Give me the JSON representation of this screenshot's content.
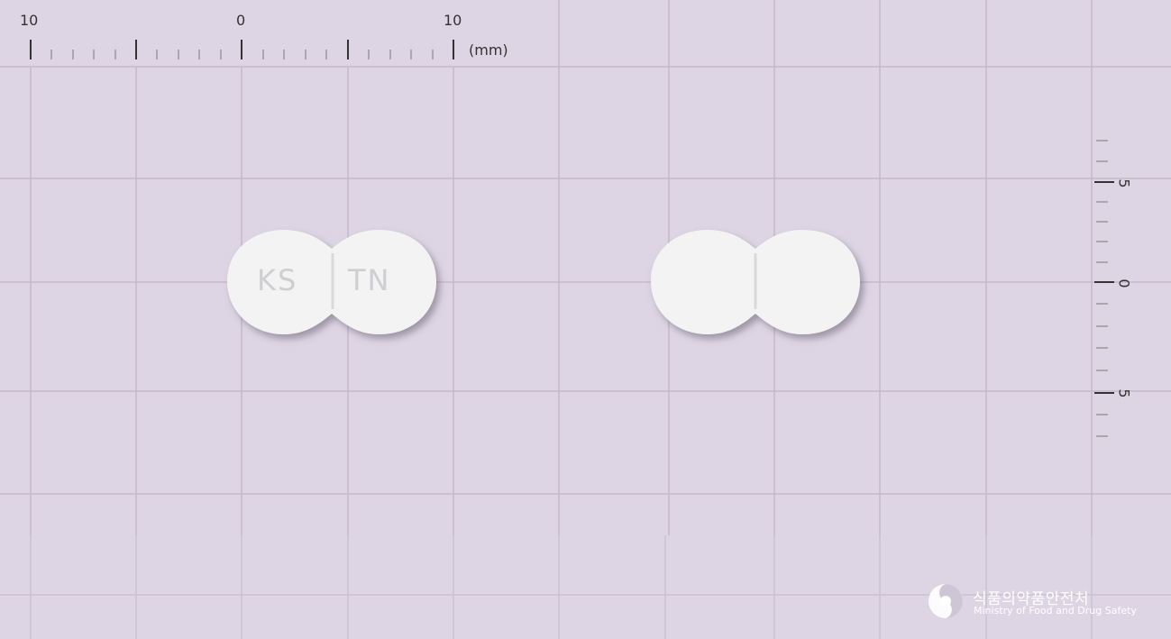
{
  "ruler_top": {
    "labels": [
      "10",
      "0",
      "10"
    ],
    "unit": "(mm)"
  },
  "ruler_right": {
    "labels": [
      "5",
      "0",
      "5"
    ]
  },
  "tablet_front": {
    "imprint_left": "KS",
    "imprint_right": "TN"
  },
  "tablet_back": {},
  "watermark": {
    "korean": "식품의약품안전처",
    "english": "Ministry of Food and Drug Safety"
  },
  "colors": {
    "background": "#ddd5e3",
    "grid": "#c6bccd",
    "tablet": "#f4f4f5"
  }
}
